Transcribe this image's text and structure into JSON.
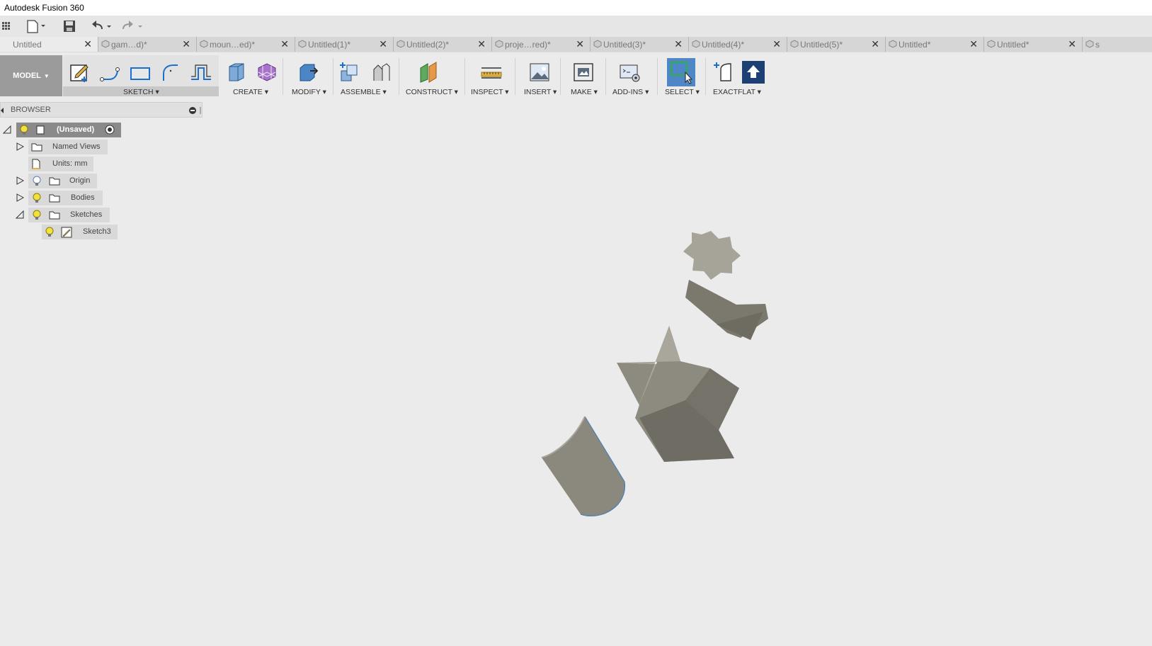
{
  "app": {
    "title": "Autodesk Fusion 360"
  },
  "tabs": [
    {
      "label": "Untitled",
      "active": true
    },
    {
      "label": "gam…d)*"
    },
    {
      "label": "moun…ed)*"
    },
    {
      "label": "Untitled(1)*"
    },
    {
      "label": "Untitled(2)*"
    },
    {
      "label": "proje…red)*"
    },
    {
      "label": "Untitled(3)*"
    },
    {
      "label": "Untitled(4)*"
    },
    {
      "label": "Untitled(5)*"
    },
    {
      "label": "Untitled*"
    },
    {
      "label": "Untitled*"
    },
    {
      "label": "s"
    }
  ],
  "toolbar": {
    "workspace": "MODEL",
    "groups": [
      "SKETCH",
      "CREATE",
      "MODIFY",
      "ASSEMBLE",
      "CONSTRUCT",
      "INSPECT",
      "INSERT",
      "MAKE",
      "ADD-INS",
      "SELECT",
      "EXACTFLAT"
    ]
  },
  "browser": {
    "title": "BROWSER",
    "items": [
      {
        "label": "(Unsaved)"
      },
      {
        "label": "Named Views"
      },
      {
        "label": "Units: mm"
      },
      {
        "label": "Origin"
      },
      {
        "label": "Bodies"
      },
      {
        "label": "Sketches"
      },
      {
        "label": "Sketch3"
      }
    ]
  },
  "colors": {
    "accent": "#4a7fb5",
    "body": "#8a877c",
    "background": "#ebebeb"
  }
}
